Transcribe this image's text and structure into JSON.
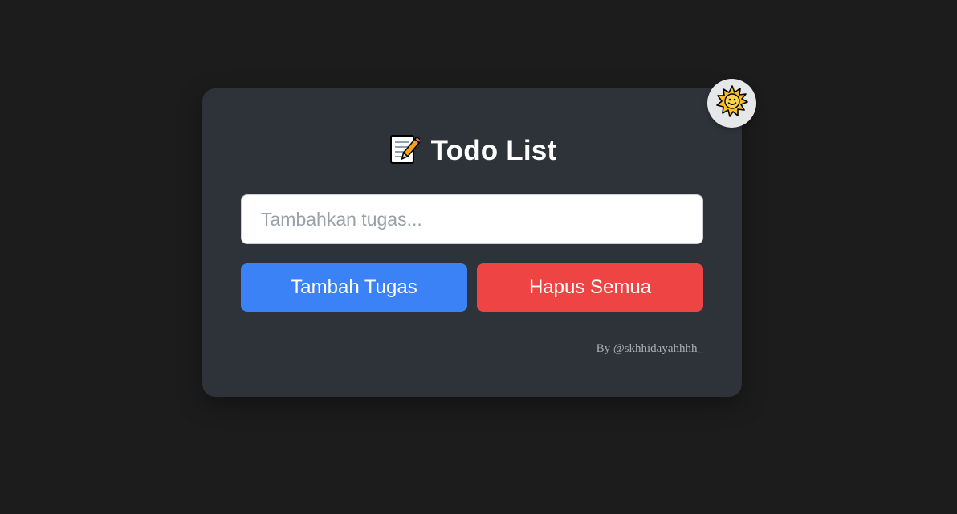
{
  "app": {
    "title": "Todo List",
    "title_icon": "memo-icon",
    "theme_toggle_icon": "sun-icon"
  },
  "form": {
    "input_placeholder": "Tambahkan tugas...",
    "input_value": "",
    "add_button_label": "Tambah Tugas",
    "clear_button_label": "Hapus Semua"
  },
  "footer": {
    "credit": "By @skhhidayahhhh_"
  },
  "colors": {
    "background": "#1c1c1c",
    "card": "#2d3339",
    "add_button": "#3b82f6",
    "clear_button": "#ef4444",
    "toggle": "#e6e7e8"
  }
}
